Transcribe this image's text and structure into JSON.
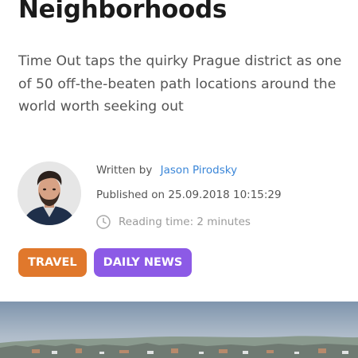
{
  "article": {
    "title": "Neighborhoods",
    "lead": "Time Out taps the quirky Prague district as one of 50 off-the-beaten path locations around the world worth seeking out"
  },
  "meta": {
    "written_by_label": "Written by",
    "author_name": "Jason Pirodsky",
    "published": "Published on 25.09.2018 10:15:29",
    "reading_time": "Reading time: 2 minutes"
  },
  "tags": [
    {
      "label": "TRAVEL",
      "color": "#e0782c"
    },
    {
      "label": "DAILY NEWS",
      "color": "#8c5ae6"
    }
  ],
  "icons": {
    "clock": "clock-icon"
  },
  "colors": {
    "title_text": "#1b1b1b",
    "body_text": "#555555",
    "link": "#3a86d8",
    "muted": "#9a9a9a"
  }
}
